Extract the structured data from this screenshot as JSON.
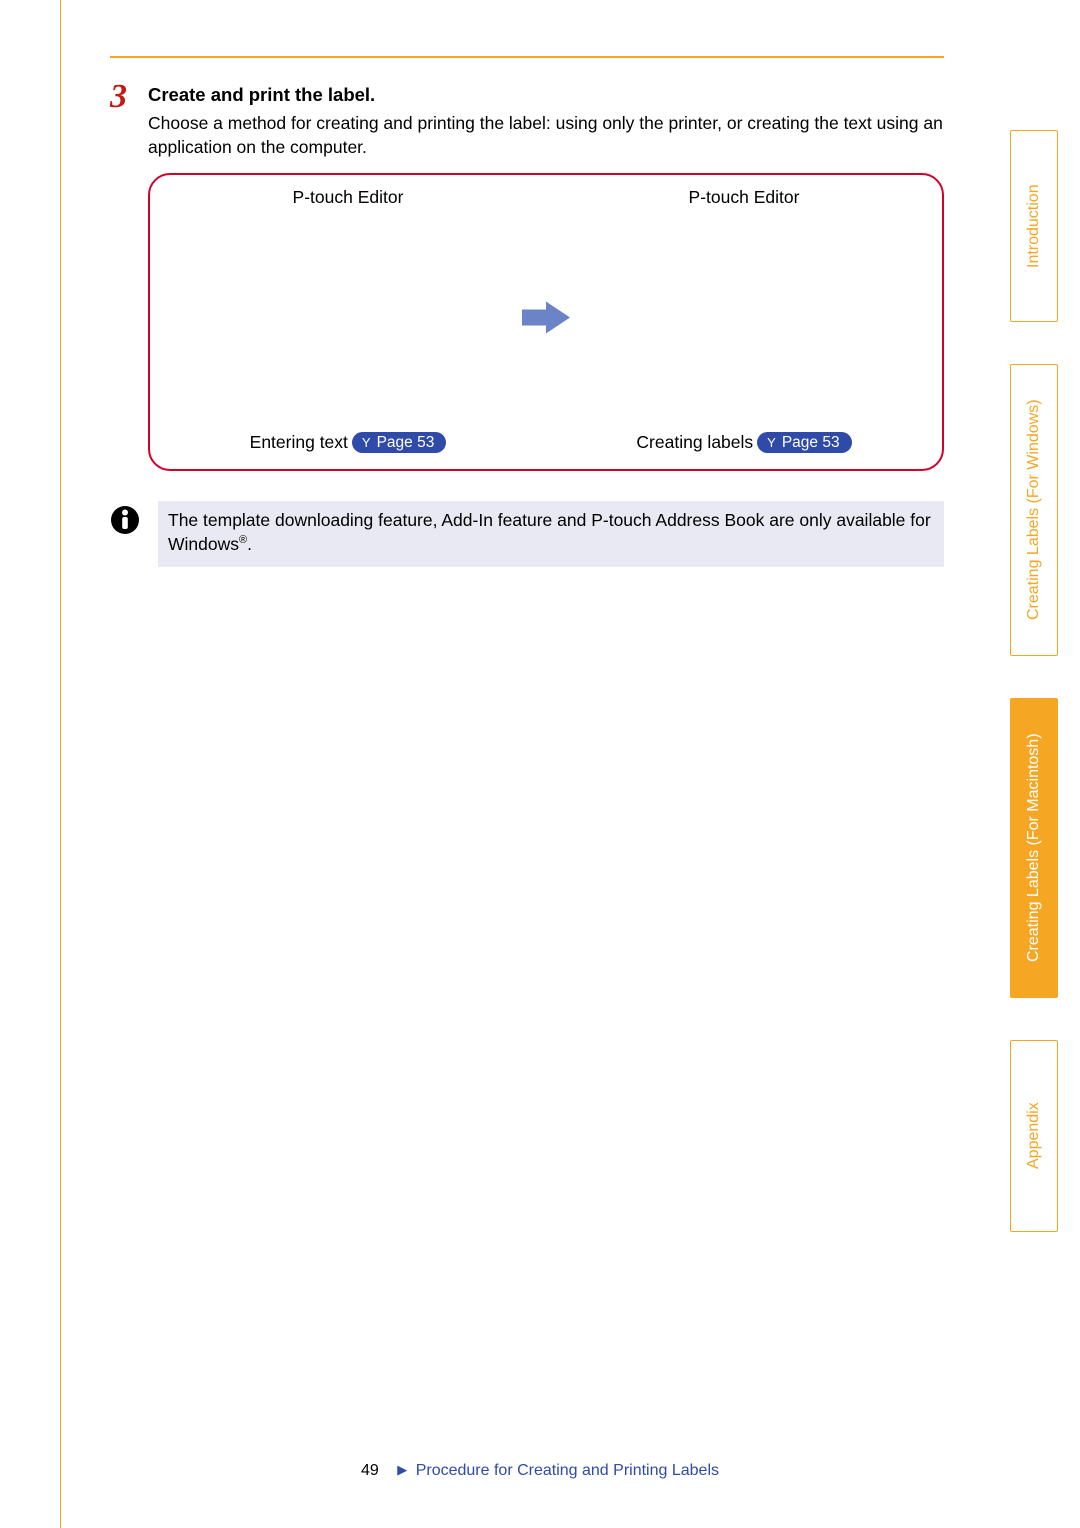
{
  "step": {
    "number": "3",
    "title": "Create and print the label.",
    "description": "Choose a method for creating and printing the label: using only the printer, or creating the text using an application on the computer."
  },
  "diagram": {
    "left": {
      "title": "P-touch Editor",
      "ref_label": "Entering text",
      "badge_arrow": "Y",
      "badge_page": "Page 53"
    },
    "right": {
      "title": "P-touch Editor",
      "ref_label": "Creating labels",
      "badge_arrow": "Y",
      "badge_page": "Page 53"
    }
  },
  "note": {
    "text_before": "The template downloading feature, Add-In feature and P-touch Address Book are only available for Windows",
    "reg": "®",
    "text_after": "."
  },
  "sidetabs": {
    "t1": "Introduction",
    "t2": "Creating Labels (For Windows)",
    "t3": "Creating Labels (For Macintosh)",
    "t4": "Appendix"
  },
  "footer": {
    "page": "49",
    "title": "Procedure for Creating and Printing Labels"
  }
}
